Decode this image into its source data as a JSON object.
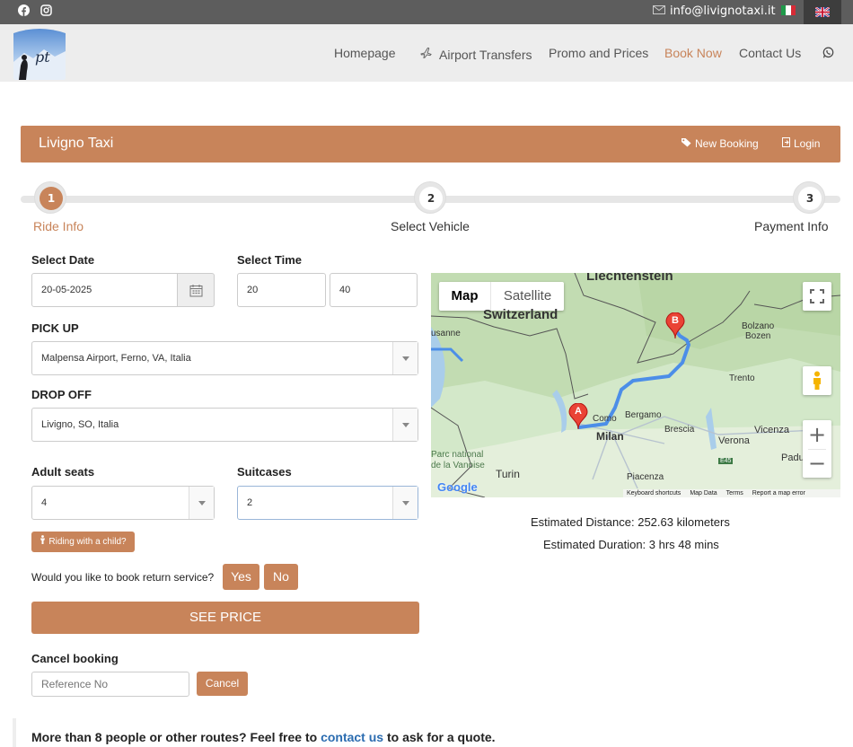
{
  "topbar": {
    "email": "info@livignotaxi.it",
    "social_icons": [
      "facebook-icon",
      "instagram-icon"
    ],
    "languages": [
      "it",
      "en"
    ]
  },
  "nav": {
    "items": [
      "Homepage",
      "Airport Transfers",
      "Promo and Prices",
      "Book Now",
      "Contact Us"
    ],
    "active": "Book Now",
    "whatsapp_icon": "whatsapp-icon",
    "logo_text": "pt"
  },
  "header": {
    "title": "Livigno Taxi",
    "new_booking": "New Booking",
    "login": "Login"
  },
  "steps": [
    {
      "num": "1",
      "label": "Ride Info"
    },
    {
      "num": "2",
      "label": "Select Vehicle"
    },
    {
      "num": "3",
      "label": "Payment Info"
    }
  ],
  "form": {
    "date_label": "Select Date",
    "date_value": "20-05-2025",
    "time_label": "Select Time",
    "hour_value": "20",
    "minute_value": "40",
    "pickup_label": "PICK UP",
    "pickup_value": "Malpensa Airport, Ferno, VA, Italia",
    "dropoff_label": "DROP OFF",
    "dropoff_value": "Livigno, SO, Italia",
    "adults_label": "Adult seats",
    "adults_value": "4",
    "suitcases_label": "Suitcases",
    "suitcases_value": "2",
    "child_button": "Riding with a child?",
    "return_question": "Would you like to book return service?",
    "yes": "Yes",
    "no": "No",
    "see_price": "SEE PRICE",
    "cancel_label": "Cancel booking",
    "reference_placeholder": "Reference No",
    "cancel_button": "Cancel"
  },
  "map": {
    "tab_map": "Map",
    "tab_satellite": "Satellite",
    "places": [
      "Liechtenstein",
      "Switzerland",
      "Bolzano",
      "Bozen",
      "Trento",
      "Como",
      "Bergamo",
      "Brescia",
      "Milan",
      "Verona",
      "Vicenza",
      "Padu",
      "Turin",
      "Piacenza",
      "Parc national de la Vanoise",
      "usanne",
      "E45"
    ],
    "marker_a": "A",
    "marker_b": "B",
    "google": "Google",
    "footer": [
      "Keyboard shortcuts",
      "Map Data",
      "Terms",
      "Report a map error"
    ]
  },
  "estimate": {
    "distance": "Estimated Distance: 252.63 kilometers",
    "duration": "Estimated Duration: 3 hrs 48 mins"
  },
  "footer_note": {
    "before": "More than 8 people or other routes? Feel free to ",
    "link": "contact us",
    "after": " to ask for a quote."
  },
  "colors": {
    "brand": "#c8845a",
    "topbar": "#5d5d5d",
    "navbar": "#ededed",
    "link": "#2b6cb0"
  }
}
